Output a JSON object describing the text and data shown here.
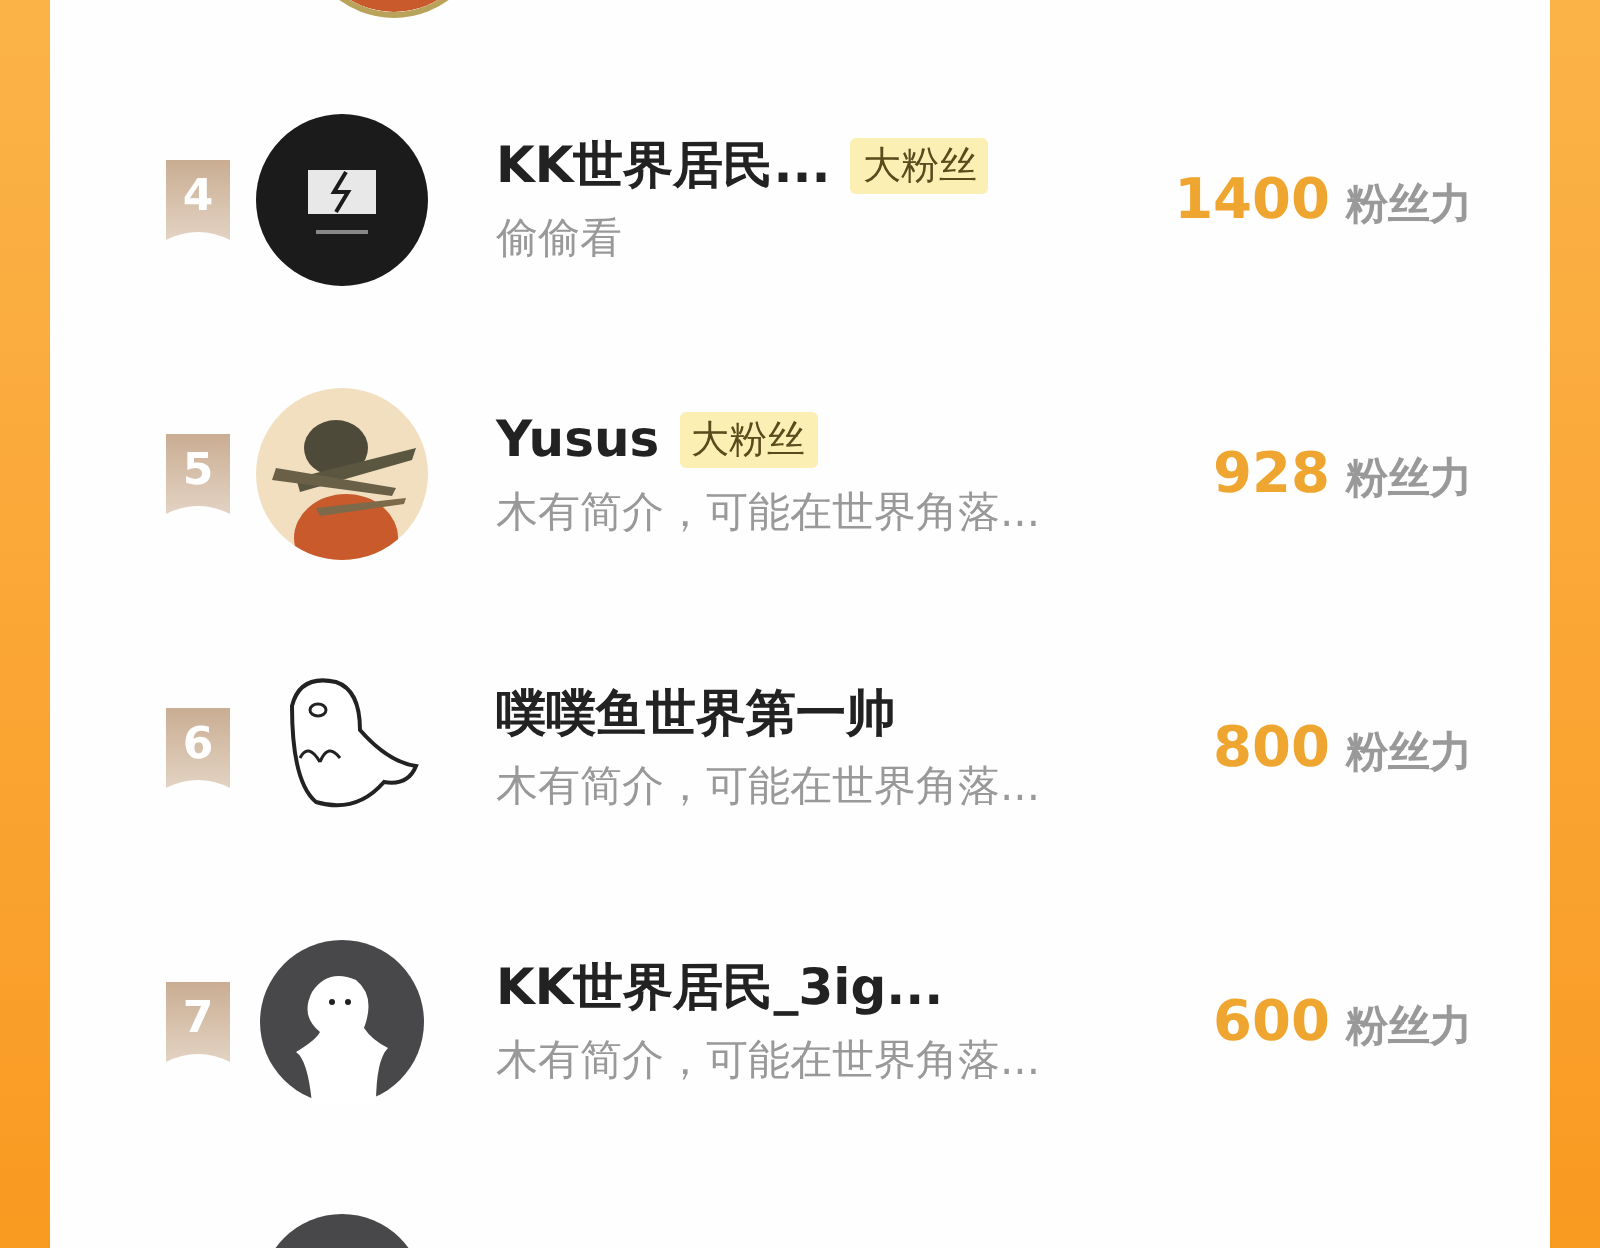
{
  "ranking": [
    {
      "rank": "4",
      "avatar": {
        "kind": "broken"
      },
      "name": "KK世界居民...",
      "badge": "大粉丝",
      "bio": "偷偷看",
      "score": "1400",
      "unit": "粉丝力"
    },
    {
      "rank": "5",
      "name": "Yusus",
      "badge": "大粉丝",
      "bio": "木有简介，可能在世界角落...",
      "score": "928",
      "unit": "粉丝力"
    },
    {
      "rank": "6",
      "avatar": {
        "kind": "seal"
      },
      "name": "噗噗鱼世界第一帅",
      "bio": "木有简介，可能在世界角落...",
      "score": "800",
      "unit": "粉丝力"
    },
    {
      "rank": "7",
      "avatar": {
        "kind": "default"
      },
      "name": "KK世界居民_3ig...",
      "bio": "木有简介，可能在世界角落...",
      "score": "600",
      "unit": "粉丝力"
    },
    {
      "avatar": {
        "kind": "default"
      }
    }
  ]
}
